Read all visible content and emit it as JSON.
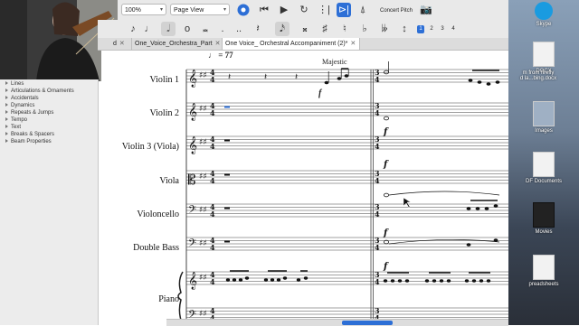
{
  "toolbar": {
    "zoom_value": "100%",
    "view_mode": "Page View",
    "concert_pitch_label": "Concert Pitch",
    "voice_numbers": [
      "1",
      "2",
      "3",
      "4"
    ]
  },
  "palette": {
    "items": [
      "Lines",
      "Articulations & Ornaments",
      "Accidentals",
      "Dynamics",
      "Repeats & Jumps",
      "Tempo",
      "Text",
      "Breaks & Spacers",
      "Beam Properties"
    ]
  },
  "tabs": [
    {
      "label": "d",
      "closable": true
    },
    {
      "label": "One_Voice_Orchestra_Part",
      "closable": true
    },
    {
      "label": "One Voice_ Orchestral Accompaniment (2)*",
      "closable": true
    }
  ],
  "score": {
    "tempo_marking": "♩ = 77",
    "expression": "Majestic",
    "dynamic": "f",
    "instruments": [
      "Violin 1",
      "Violin 2",
      "Violin 3 (Viola)",
      "Viola",
      "Violoncello",
      "Double Bass",
      "Piano"
    ]
  },
  "desktop": {
    "items": [
      {
        "label": "Skype",
        "icon": "skype-icon"
      },
      {
        "label": "DOCX",
        "icon": "document-icon"
      },
      {
        "label": "m from firefly\nd la...bing.docx",
        "icon": "document-icon"
      },
      {
        "label": "Images",
        "icon": "folder-icon"
      },
      {
        "label": "DF Documents",
        "icon": "folder-icon"
      },
      {
        "label": "Movies",
        "icon": "folder-icon"
      },
      {
        "label": "preadsheets",
        "icon": "folder-icon"
      }
    ]
  },
  "colors": {
    "accent": "#2d6fd6",
    "toolbar": "#e9e9e9"
  }
}
